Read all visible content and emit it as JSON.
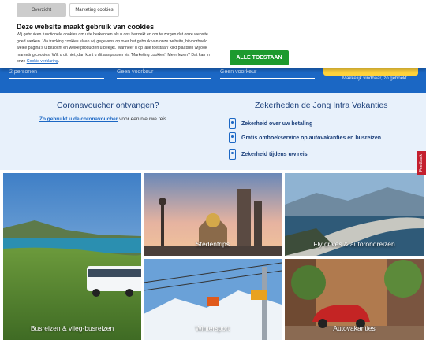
{
  "cookie": {
    "tabs": [
      "Overzicht",
      "Marketing cookies"
    ],
    "title": "Deze website maakt gebruik van cookies",
    "text": "Wij gebruiken functionele cookies om u te herkennen als u ons bezoekt en om te zorgen dat onze website goed werken. Via tracking cookies slaan wij gegevens op over het gebruik van onze website, bijvoorbeeld welke pagina's u bezocht en welke producten u bekijkt. Wanneer u op 'alle toestaan' klikt plaatsen wij ook marketing cookies. Wilt u dit niet, dan kunt u dit aanpassen via 'Marketing cookies'. Meer lezen? Dat kan in onze",
    "link": "Cookie verklaring",
    "accept": "ALLE TOESTAAN"
  },
  "hero": {
    "fields": [
      "2 personen",
      "Geen voorkeur",
      "Geen voorkeur"
    ],
    "note": "Makkelijk vindbaar, zo geboekt"
  },
  "voucher": {
    "title": "Coronavoucher ontvangen?",
    "link": "Zo gebruikt u de coronavoucher",
    "rest": "voor een nieuwe reis."
  },
  "sureties": {
    "title": "Zekerheden de Jong Intra Vakanties",
    "items": [
      "Zekerheid over uw betaling",
      "Gratis omboekservice op autovakanties en busreizen",
      "Zekerheid tijdens uw reis"
    ]
  },
  "tiles": [
    "Busreizen & vlieg-busreizen",
    "Stedentrips",
    "Fly drives & autorondreizen",
    "Wintersport",
    "Autovakanties"
  ],
  "feedback": "Feedback",
  "colors": {
    "brand_blue": "#1b67c4",
    "accept_green": "#1d9a2e",
    "title_navy": "#1b3f7a",
    "feedback_red": "#c41f2e"
  }
}
